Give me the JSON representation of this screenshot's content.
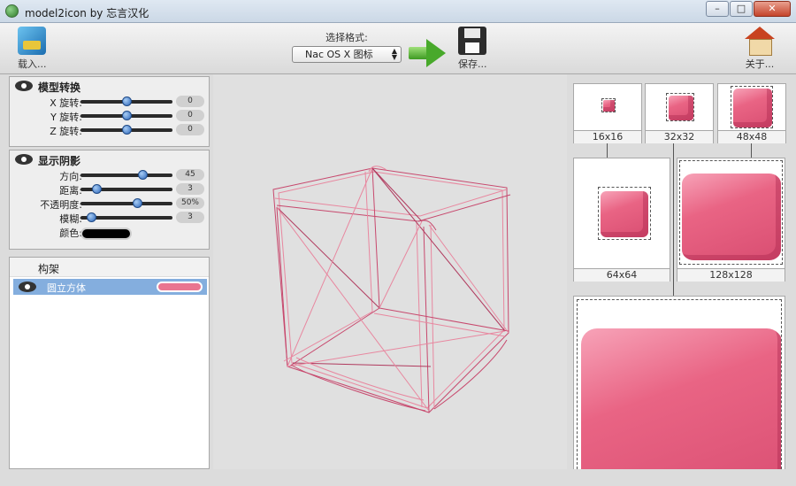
{
  "window": {
    "title": "model2icon by 忘言汉化",
    "minimize": "–",
    "maximize": "□",
    "close": "✕"
  },
  "toolbar": {
    "load_label": "载入...",
    "format_label": "选择格式:",
    "format_value": "Nac OS X 图标",
    "save_label": "保存...",
    "about_label": "关于..."
  },
  "model_transform": {
    "title": "模型转换",
    "sliders": [
      {
        "label": "X 旋转:",
        "value": "0",
        "position": 0.5
      },
      {
        "label": "Y 旋转:",
        "value": "0",
        "position": 0.5
      },
      {
        "label": "Z 旋转:",
        "value": "0",
        "position": 0.5
      }
    ]
  },
  "shadow": {
    "title": "显示阴影",
    "sliders": [
      {
        "label": "方向:",
        "value": "45",
        "position": 0.67
      },
      {
        "label": "距离:",
        "value": "3",
        "position": 0.17
      },
      {
        "label": "不透明度:",
        "value": "50%",
        "position": 0.62
      },
      {
        "label": "模糊:",
        "value": "3",
        "position": 0.12
      }
    ],
    "color_label": "颜色:",
    "color": "#000000"
  },
  "rig": {
    "title": "构架",
    "items": [
      {
        "name": "圆立方体",
        "color": "#e97590"
      }
    ]
  },
  "previews": [
    "16x16",
    "32x32",
    "48x48",
    "64x64",
    "128x128"
  ],
  "colors": {
    "cube_pink": "#e96484",
    "wire": "#c7486d"
  }
}
